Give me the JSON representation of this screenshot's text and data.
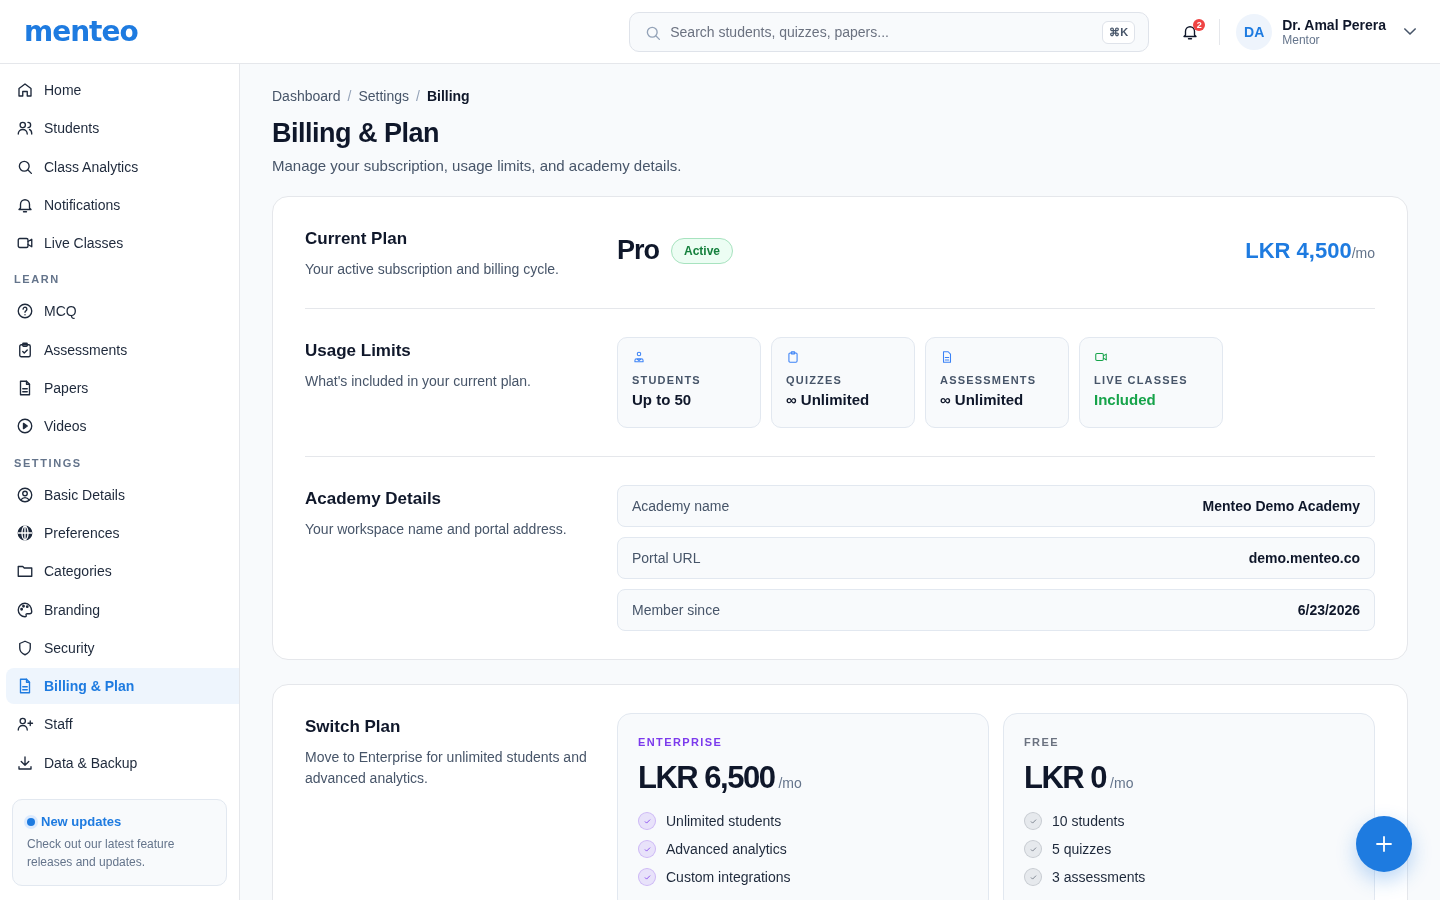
{
  "header": {
    "logo": "menteo",
    "search": {
      "placeholder": "Search students, quizzes, papers...",
      "shortcut": "⌘K"
    },
    "notifications": {
      "count": "2"
    },
    "user": {
      "initials": "DA",
      "name": "Dr. Amal Perera",
      "role": "Mentor"
    }
  },
  "sidebar": {
    "groups": [
      {
        "items": [
          {
            "label": "Home",
            "kind": "home",
            "selected": false
          },
          {
            "label": "Students",
            "kind": "users",
            "selected": false
          },
          {
            "label": "Class Analytics",
            "kind": "search",
            "selected": false
          },
          {
            "label": "Notifications",
            "kind": "bell",
            "selected": false
          },
          {
            "label": "Live Classes",
            "kind": "video",
            "selected": false
          }
        ]
      },
      {
        "title": "LEARN",
        "items": [
          {
            "label": "MCQ",
            "kind": "help",
            "selected": false
          },
          {
            "label": "Assessments",
            "kind": "clipboard",
            "selected": false
          },
          {
            "label": "Papers",
            "kind": "file",
            "selected": false
          },
          {
            "label": "Videos",
            "kind": "play",
            "selected": false
          }
        ]
      },
      {
        "title": "SETTINGS",
        "items": [
          {
            "label": "Basic Details",
            "kind": "user-circle",
            "selected": false
          },
          {
            "label": "Preferences",
            "kind": "globe",
            "selected": false
          },
          {
            "label": "Categories",
            "kind": "folder",
            "selected": false
          },
          {
            "label": "Branding",
            "kind": "palette",
            "selected": false
          },
          {
            "label": "Security",
            "kind": "shield",
            "selected": false
          },
          {
            "label": "Billing & Plan",
            "kind": "file",
            "selected": true
          },
          {
            "label": "Staff",
            "kind": "user-plus",
            "selected": false
          },
          {
            "label": "Data & Backup",
            "kind": "download",
            "selected": false
          }
        ]
      }
    ],
    "updates": {
      "title": "New updates",
      "text": "Check out our latest feature releases and updates."
    }
  },
  "breadcrumb": [
    {
      "kind": "link",
      "label": "Dashboard",
      "selected": false
    },
    {
      "kind": "separator",
      "label": "/"
    },
    {
      "kind": "link",
      "label": "Settings",
      "selected": false
    },
    {
      "kind": "separator",
      "label": "/"
    },
    {
      "kind": "link",
      "label": "Billing",
      "selected": true
    }
  ],
  "page": {
    "title": "Billing & Plan",
    "subtitle": "Manage your subscription, usage limits, and academy details."
  },
  "current_plan": {
    "title": "Current Plan",
    "text": "Your active subscription and billing cycle.",
    "plan": "Pro",
    "status": "Active",
    "price": "LKR 4,500",
    "period": "/mo"
  },
  "usage": {
    "title": "Usage Limits",
    "text": "What's included in your current plan.",
    "items": [
      {
        "kind": "students",
        "label": "STUDENTS",
        "value": "Up to 50",
        "highlight": false
      },
      {
        "kind": "quizzes",
        "label": "QUIZZES",
        "value": "∞ Unlimited",
        "highlight": false
      },
      {
        "kind": "assessments",
        "label": "ASSESSMENTS",
        "value": "∞ Unlimited",
        "highlight": false
      },
      {
        "kind": "live",
        "label": "LIVE CLASSES",
        "value": "Included",
        "highlight": true
      }
    ]
  },
  "academy": {
    "title": "Academy Details",
    "text": "Your workspace name and portal address.",
    "rows": [
      {
        "label": "Academy name",
        "value": "Menteo Demo Academy"
      },
      {
        "label": "Portal URL",
        "value": "demo.menteo.co"
      },
      {
        "label": "Member since",
        "value": "6/23/2026"
      }
    ]
  },
  "switch_plan": {
    "title": "Switch Plan",
    "text": "Move to Enterprise for unlimited students and advanced analytics.",
    "plans": [
      {
        "name": "ENTERPRISE",
        "color": "#7c3aed",
        "price": "LKR 6,500",
        "period": "/mo",
        "features": [
          "Unlimited students",
          "Advanced analytics",
          "Custom integrations"
        ]
      },
      {
        "name": "FREE",
        "color": "#6b7280",
        "price": "LKR 0",
        "period": "/mo",
        "features": [
          "10 students",
          "5 quizzes",
          "3 assessments"
        ]
      }
    ]
  }
}
